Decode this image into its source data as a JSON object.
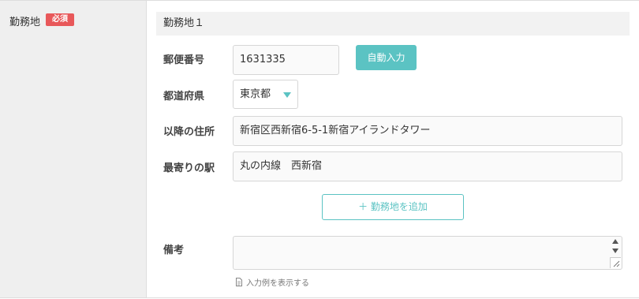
{
  "field": {
    "label": "勤務地",
    "required_badge": "必須"
  },
  "section": {
    "title": "勤務地１"
  },
  "postal": {
    "label": "郵便番号",
    "value": "1631335",
    "auto_button": "自動入力"
  },
  "prefecture": {
    "label": "都道府県",
    "selected": "東京都"
  },
  "address": {
    "label": "以降の住所",
    "value": "新宿区西新宿6-5-1新宿アイランドタワー"
  },
  "station": {
    "label": "最寄りの駅",
    "value": "丸の内線　西新宿"
  },
  "add_location": {
    "label": "＋ 勤務地を追加"
  },
  "notes": {
    "label": "備考",
    "value": "",
    "hint_link": "入力例を表示する"
  },
  "colors": {
    "accent": "#5bc3c3",
    "required": "#e8585a",
    "label_bg": "#efefef"
  }
}
